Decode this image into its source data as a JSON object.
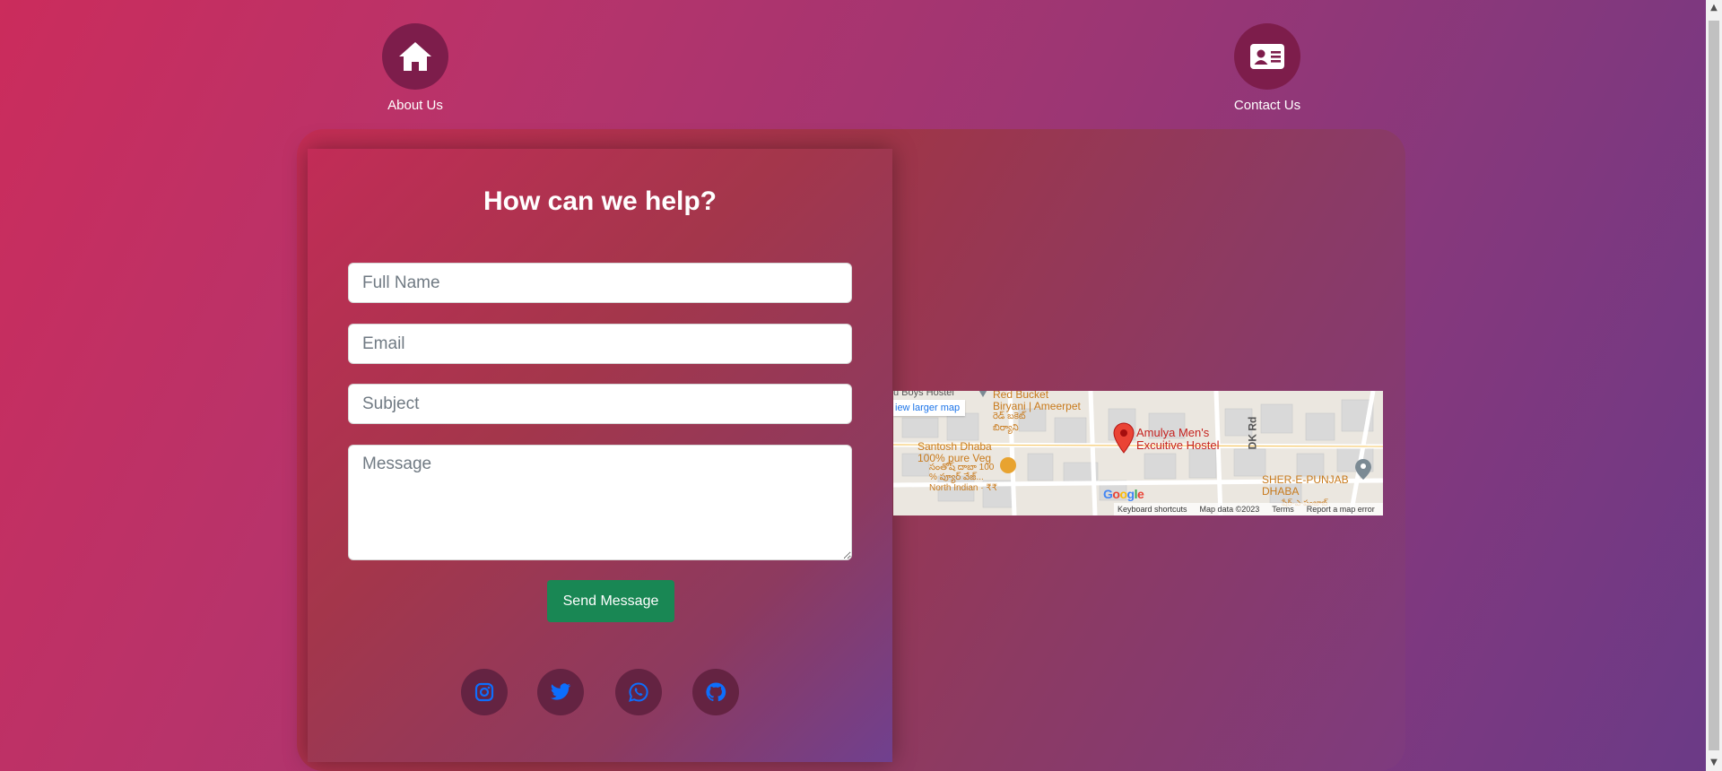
{
  "nav": {
    "about_label": "About Us",
    "contact_label": "Contact Us"
  },
  "form": {
    "title": "How can we help?",
    "full_name_placeholder": "Full Name",
    "email_placeholder": "Email",
    "subject_placeholder": "Subject",
    "message_placeholder": "Message",
    "send_label": "Send Message"
  },
  "social": [
    "instagram-icon",
    "twitter-icon",
    "whatsapp-icon",
    "github-icon"
  ],
  "map": {
    "larger_map_link": "iew larger map",
    "top_left_label": "u Boys Hostel",
    "poi_red_bucket": "Red Bucket\nBiryani | Ameerpet",
    "poi_red_bucket_telugu": "రెడ్ బకెట్\nబిర్యాని",
    "poi_santosh": "Santosh Dhaba\n100% pure Veg",
    "poi_santosh_sub": "సంతోష్ దాబా 100\n% ప్యూర్ వేజ్...",
    "poi_santosh_cat": "North Indian · ₹₹",
    "marker_label": "Amulya Men's\nExcuitive Hostel",
    "road_label": "DK Rd",
    "poi_sher": "SHER-E-PUNJAB\nDHABA",
    "poi_sher_telugu": "షేర్-ఎ-పంజాబ్",
    "google_logo": "Google",
    "footer": {
      "keyboard": "Keyboard shortcuts",
      "data": "Map data ©2023",
      "terms": "Terms",
      "report": "Report a map error"
    }
  },
  "colors": {
    "accent_green": "#198754",
    "icon_blue": "#0d6efd",
    "nav_circle": "#7d1d4b"
  }
}
